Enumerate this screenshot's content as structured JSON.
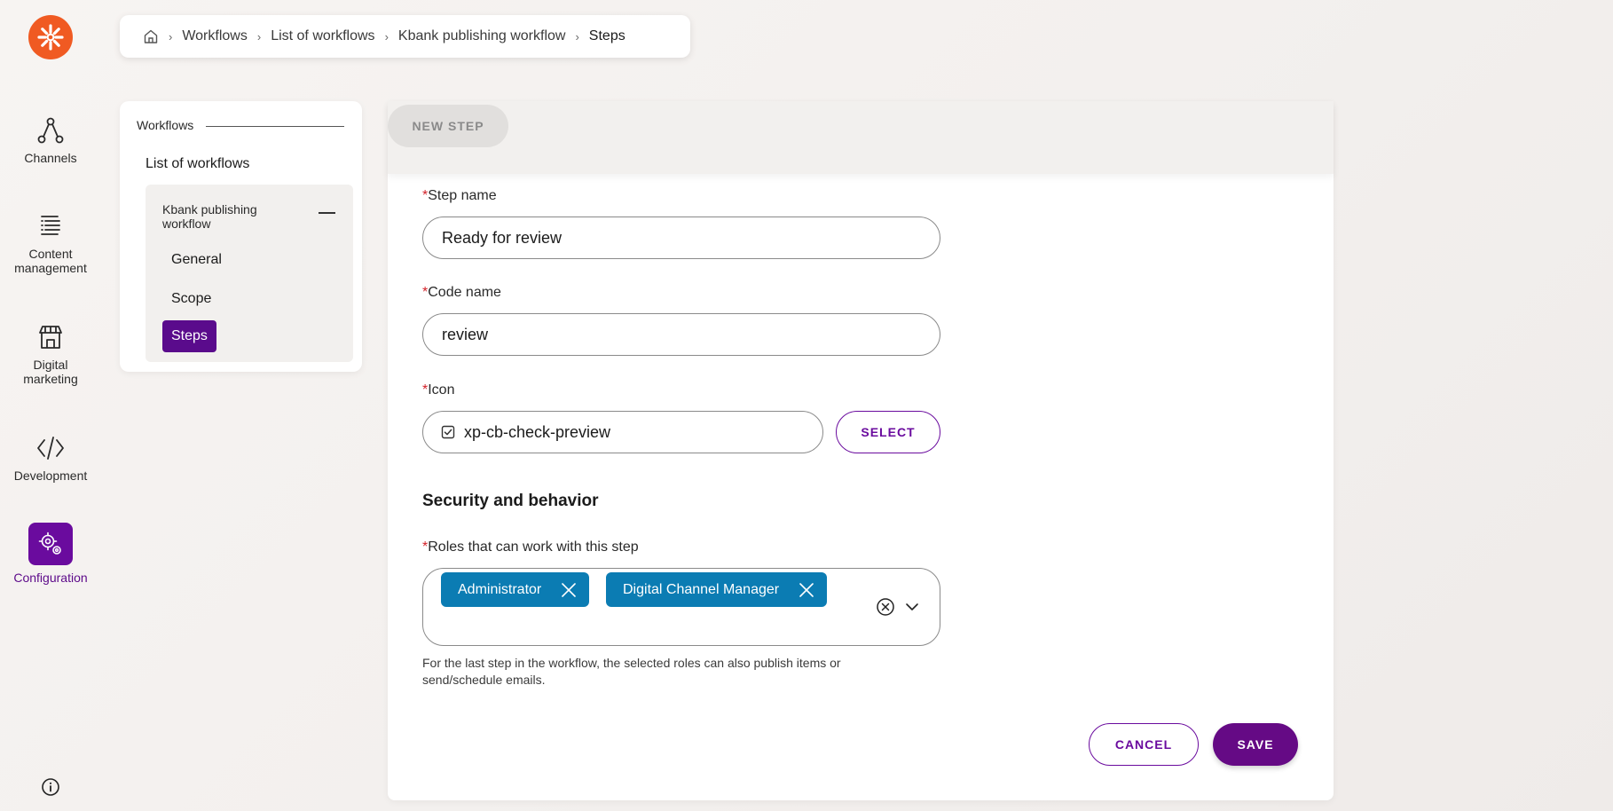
{
  "breadcrumb": {
    "items": [
      "Workflows",
      "List of workflows",
      "Kbank publishing workflow"
    ],
    "current": "Steps"
  },
  "rail": {
    "items": [
      {
        "label": "Channels",
        "icon": "channels-icon"
      },
      {
        "label": "Content management",
        "icon": "content-management-icon"
      },
      {
        "label": "Digital marketing",
        "icon": "store-icon"
      },
      {
        "label": "Development",
        "icon": "code-icon"
      },
      {
        "label": "Configuration",
        "icon": "gear-icon"
      }
    ],
    "active": "Configuration"
  },
  "subnav": {
    "group": "Workflows",
    "list_label": "List of workflows",
    "panel_title": "Kbank publishing workflow",
    "items": [
      "General",
      "Scope",
      "Steps"
    ],
    "active": "Steps"
  },
  "main": {
    "new_step": "NEW STEP",
    "step_name": {
      "label": "Step name",
      "value": "Ready for review"
    },
    "code_name": {
      "label": "Code name",
      "value": "review"
    },
    "icon": {
      "label": "Icon",
      "value": "xp-cb-check-preview",
      "button": "SELECT"
    },
    "section_title": "Security and behavior",
    "roles": {
      "label": "Roles that can work with this step",
      "tags": [
        "Administrator",
        "Digital Channel Manager"
      ],
      "helper": "For the last step in the workflow, the selected roles can also publish items or send/schedule emails."
    },
    "cancel": "CANCEL",
    "save": "SAVE"
  },
  "colors": {
    "accent": "#6a0b9e",
    "logo": "#f05a22",
    "tag": "#0b7cb3",
    "required": "#d3232b"
  }
}
